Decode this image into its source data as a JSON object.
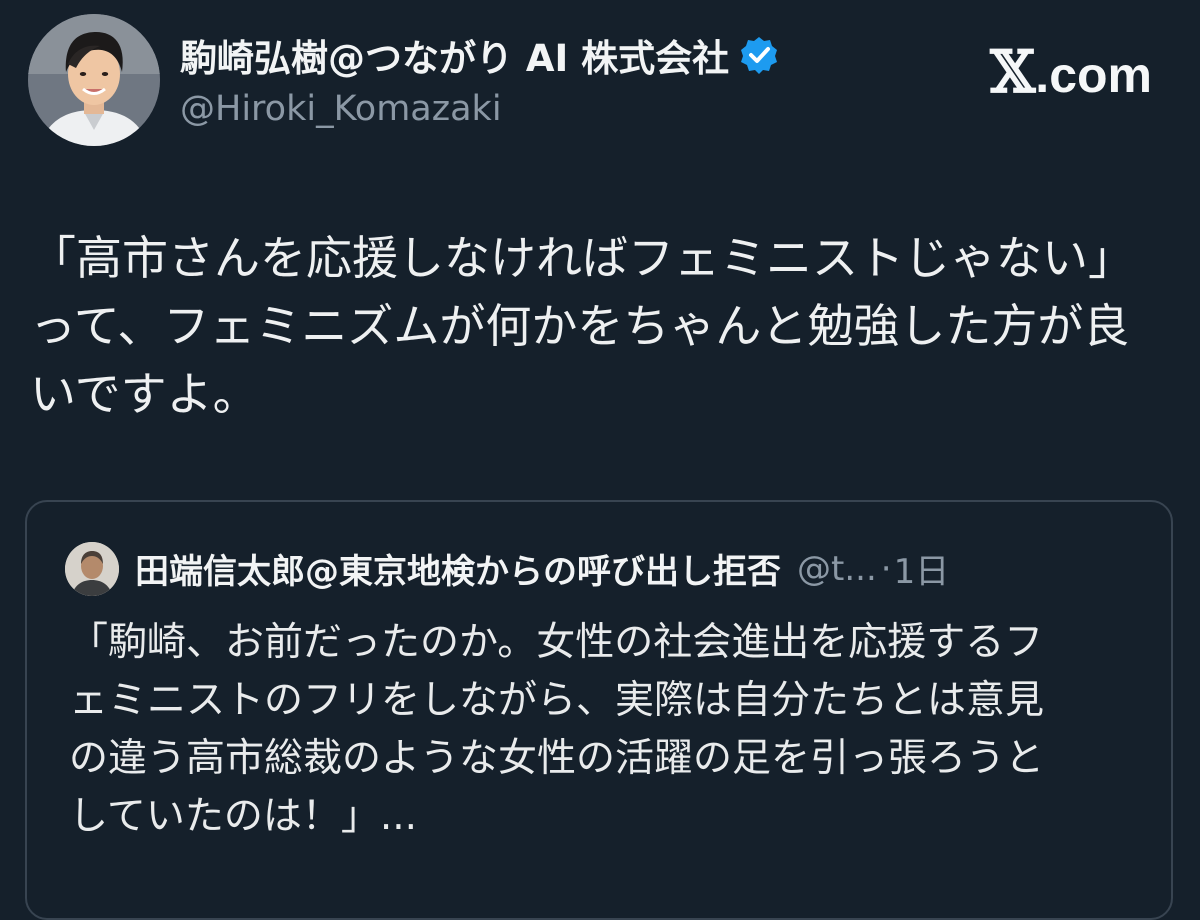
{
  "author": {
    "name": "駒崎弘樹@つながり AI 株式会社",
    "handle": "@Hiroki_Komazaki",
    "verified_icon": "verified-badge-icon",
    "verified_color": "#1d9bf0"
  },
  "brand": {
    "x_mark": "𝕏",
    "suffix": ".com"
  },
  "tweet": {
    "text": "「高市さんを応援しなければフェミニストじゃない」\nって、フェミニズムが何かをちゃんと勉強した方が良\nいですよ。"
  },
  "quoted": {
    "name": "田端信太郎@東京地検からの呼び出し拒否",
    "handle": "@t...",
    "separator": "·",
    "time": "1日",
    "text": "「駒崎、お前だったのか。女性の社会進出を応援するフ\nェミニストのフリをしながら、実際は自分たちとは意見\nの違う高市総裁のような女性の活躍の足を引っ張ろうと\nしていたのは！」..."
  },
  "colors": {
    "background": "#15202b",
    "text_primary": "#e7e9ea",
    "text_secondary": "#8b98a5",
    "border": "#384451"
  }
}
